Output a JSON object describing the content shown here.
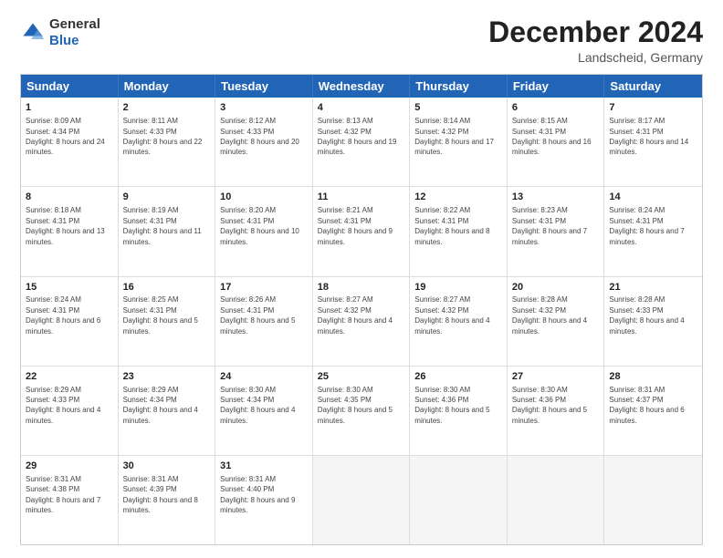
{
  "header": {
    "logo_general": "General",
    "logo_blue": "Blue",
    "month_title": "December 2024",
    "location": "Landscheid, Germany"
  },
  "calendar": {
    "days": [
      "Sunday",
      "Monday",
      "Tuesday",
      "Wednesday",
      "Thursday",
      "Friday",
      "Saturday"
    ],
    "rows": [
      [
        {
          "day": "1",
          "sunrise": "Sunrise: 8:09 AM",
          "sunset": "Sunset: 4:34 PM",
          "daylight": "Daylight: 8 hours and 24 minutes."
        },
        {
          "day": "2",
          "sunrise": "Sunrise: 8:11 AM",
          "sunset": "Sunset: 4:33 PM",
          "daylight": "Daylight: 8 hours and 22 minutes."
        },
        {
          "day": "3",
          "sunrise": "Sunrise: 8:12 AM",
          "sunset": "Sunset: 4:33 PM",
          "daylight": "Daylight: 8 hours and 20 minutes."
        },
        {
          "day": "4",
          "sunrise": "Sunrise: 8:13 AM",
          "sunset": "Sunset: 4:32 PM",
          "daylight": "Daylight: 8 hours and 19 minutes."
        },
        {
          "day": "5",
          "sunrise": "Sunrise: 8:14 AM",
          "sunset": "Sunset: 4:32 PM",
          "daylight": "Daylight: 8 hours and 17 minutes."
        },
        {
          "day": "6",
          "sunrise": "Sunrise: 8:15 AM",
          "sunset": "Sunset: 4:31 PM",
          "daylight": "Daylight: 8 hours and 16 minutes."
        },
        {
          "day": "7",
          "sunrise": "Sunrise: 8:17 AM",
          "sunset": "Sunset: 4:31 PM",
          "daylight": "Daylight: 8 hours and 14 minutes."
        }
      ],
      [
        {
          "day": "8",
          "sunrise": "Sunrise: 8:18 AM",
          "sunset": "Sunset: 4:31 PM",
          "daylight": "Daylight: 8 hours and 13 minutes."
        },
        {
          "day": "9",
          "sunrise": "Sunrise: 8:19 AM",
          "sunset": "Sunset: 4:31 PM",
          "daylight": "Daylight: 8 hours and 11 minutes."
        },
        {
          "day": "10",
          "sunrise": "Sunrise: 8:20 AM",
          "sunset": "Sunset: 4:31 PM",
          "daylight": "Daylight: 8 hours and 10 minutes."
        },
        {
          "day": "11",
          "sunrise": "Sunrise: 8:21 AM",
          "sunset": "Sunset: 4:31 PM",
          "daylight": "Daylight: 8 hours and 9 minutes."
        },
        {
          "day": "12",
          "sunrise": "Sunrise: 8:22 AM",
          "sunset": "Sunset: 4:31 PM",
          "daylight": "Daylight: 8 hours and 8 minutes."
        },
        {
          "day": "13",
          "sunrise": "Sunrise: 8:23 AM",
          "sunset": "Sunset: 4:31 PM",
          "daylight": "Daylight: 8 hours and 7 minutes."
        },
        {
          "day": "14",
          "sunrise": "Sunrise: 8:24 AM",
          "sunset": "Sunset: 4:31 PM",
          "daylight": "Daylight: 8 hours and 7 minutes."
        }
      ],
      [
        {
          "day": "15",
          "sunrise": "Sunrise: 8:24 AM",
          "sunset": "Sunset: 4:31 PM",
          "daylight": "Daylight: 8 hours and 6 minutes."
        },
        {
          "day": "16",
          "sunrise": "Sunrise: 8:25 AM",
          "sunset": "Sunset: 4:31 PM",
          "daylight": "Daylight: 8 hours and 5 minutes."
        },
        {
          "day": "17",
          "sunrise": "Sunrise: 8:26 AM",
          "sunset": "Sunset: 4:31 PM",
          "daylight": "Daylight: 8 hours and 5 minutes."
        },
        {
          "day": "18",
          "sunrise": "Sunrise: 8:27 AM",
          "sunset": "Sunset: 4:32 PM",
          "daylight": "Daylight: 8 hours and 4 minutes."
        },
        {
          "day": "19",
          "sunrise": "Sunrise: 8:27 AM",
          "sunset": "Sunset: 4:32 PM",
          "daylight": "Daylight: 8 hours and 4 minutes."
        },
        {
          "day": "20",
          "sunrise": "Sunrise: 8:28 AM",
          "sunset": "Sunset: 4:32 PM",
          "daylight": "Daylight: 8 hours and 4 minutes."
        },
        {
          "day": "21",
          "sunrise": "Sunrise: 8:28 AM",
          "sunset": "Sunset: 4:33 PM",
          "daylight": "Daylight: 8 hours and 4 minutes."
        }
      ],
      [
        {
          "day": "22",
          "sunrise": "Sunrise: 8:29 AM",
          "sunset": "Sunset: 4:33 PM",
          "daylight": "Daylight: 8 hours and 4 minutes."
        },
        {
          "day": "23",
          "sunrise": "Sunrise: 8:29 AM",
          "sunset": "Sunset: 4:34 PM",
          "daylight": "Daylight: 8 hours and 4 minutes."
        },
        {
          "day": "24",
          "sunrise": "Sunrise: 8:30 AM",
          "sunset": "Sunset: 4:34 PM",
          "daylight": "Daylight: 8 hours and 4 minutes."
        },
        {
          "day": "25",
          "sunrise": "Sunrise: 8:30 AM",
          "sunset": "Sunset: 4:35 PM",
          "daylight": "Daylight: 8 hours and 5 minutes."
        },
        {
          "day": "26",
          "sunrise": "Sunrise: 8:30 AM",
          "sunset": "Sunset: 4:36 PM",
          "daylight": "Daylight: 8 hours and 5 minutes."
        },
        {
          "day": "27",
          "sunrise": "Sunrise: 8:30 AM",
          "sunset": "Sunset: 4:36 PM",
          "daylight": "Daylight: 8 hours and 5 minutes."
        },
        {
          "day": "28",
          "sunrise": "Sunrise: 8:31 AM",
          "sunset": "Sunset: 4:37 PM",
          "daylight": "Daylight: 8 hours and 6 minutes."
        }
      ],
      [
        {
          "day": "29",
          "sunrise": "Sunrise: 8:31 AM",
          "sunset": "Sunset: 4:38 PM",
          "daylight": "Daylight: 8 hours and 7 minutes."
        },
        {
          "day": "30",
          "sunrise": "Sunrise: 8:31 AM",
          "sunset": "Sunset: 4:39 PM",
          "daylight": "Daylight: 8 hours and 8 minutes."
        },
        {
          "day": "31",
          "sunrise": "Sunrise: 8:31 AM",
          "sunset": "Sunset: 4:40 PM",
          "daylight": "Daylight: 8 hours and 9 minutes."
        },
        null,
        null,
        null,
        null
      ]
    ]
  }
}
